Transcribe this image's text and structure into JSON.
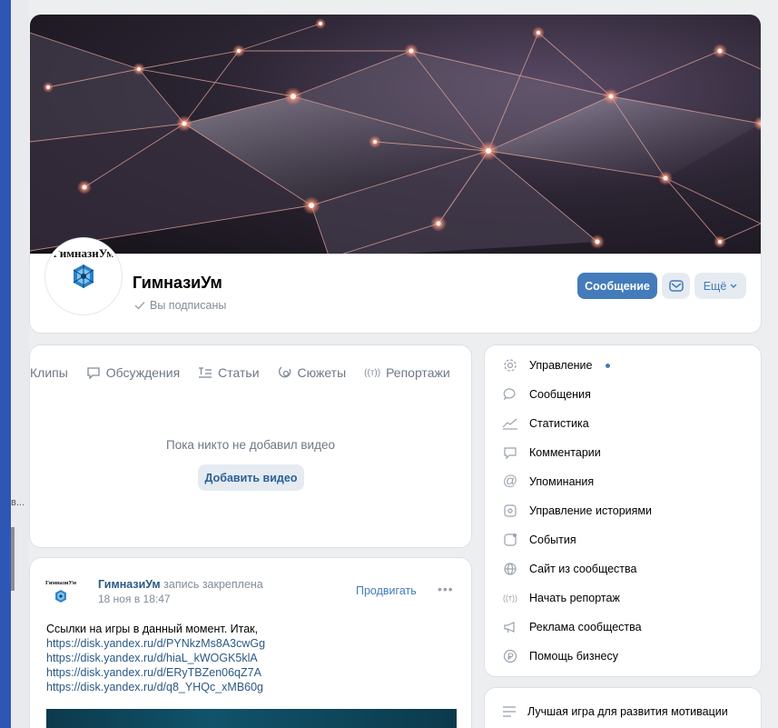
{
  "group": {
    "avatar_text": "ГимназиУм",
    "name": "ГимназиУм",
    "subscribed_label": "Вы подписаны"
  },
  "actions": {
    "message_button": "Сообщение",
    "more_button": "Ещё"
  },
  "tabs": [
    {
      "label": "Клипы",
      "icon": "clip-icon"
    },
    {
      "label": "Обсуждения",
      "icon": "chat-bubble-icon"
    },
    {
      "label": "Статьи",
      "icon": "article-icon"
    },
    {
      "label": "Сюжеты",
      "icon": "stories-icon"
    },
    {
      "label": "Репортажи",
      "icon": "broadcast-icon"
    }
  ],
  "videos": {
    "empty_text": "Пока никто не добавил видео",
    "add_button": "Добавить видео"
  },
  "post": {
    "avatar_text": "ГимназиУм",
    "author": "ГимназиУм",
    "pinned_note": "запись закреплена",
    "date": "18 ноя в 18:47",
    "promote": "Продвигать",
    "more": "•••",
    "text": "Ссылки на игры в данный момент. Итак,",
    "links": [
      "https://disk.yandex.ru/d/PYNkzMs8A3cwGg",
      "https://disk.yandex.ru/d/hiaL_kWOGK5klA",
      "https://disk.yandex.ru/d/ERyTBZen06qZ7A",
      "https://disk.yandex.ru/d/q8_YHQc_xMB60g"
    ]
  },
  "menu": {
    "items": [
      {
        "label": "Управление",
        "icon": "gear-icon",
        "indicator": true
      },
      {
        "label": "Сообщения",
        "icon": "message-icon"
      },
      {
        "label": "Статистика",
        "icon": "stats-icon"
      },
      {
        "label": "Комментарии",
        "icon": "comment-icon"
      },
      {
        "label": "Упоминания",
        "icon": "at-icon"
      },
      {
        "label": "Управление историями",
        "icon": "stories-manage-icon"
      },
      {
        "label": "События",
        "icon": "event-icon"
      },
      {
        "label": "Сайт из сообщества",
        "icon": "globe-icon"
      },
      {
        "label": "Начать репортаж",
        "icon": "broadcast-icon"
      },
      {
        "label": "Реклама сообщества",
        "icon": "megaphone-icon"
      },
      {
        "label": "Помощь бизнесу",
        "icon": "ruble-icon"
      }
    ]
  },
  "sidebar_card": {
    "label": "Лучшая игра для развития мотивации",
    "icon": "list-icon"
  },
  "left_strip": {
    "fragment": "в..."
  },
  "colors": {
    "page_bg": "#2e57b5",
    "accent": "#447bba",
    "link": "#2a5885"
  }
}
